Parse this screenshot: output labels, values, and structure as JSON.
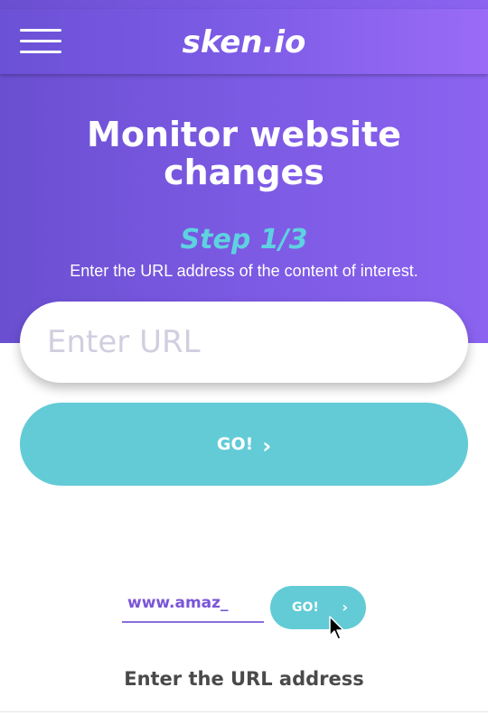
{
  "header": {
    "logo_text": "sken.io",
    "menu_icon": "hamburger-menu-icon"
  },
  "hero": {
    "title_line1": "Monitor website",
    "title_line2": "changes",
    "step": "Step 1/3",
    "subtitle": "Enter the URL address of the content of interest."
  },
  "form": {
    "url_placeholder": "Enter URL",
    "url_value": "",
    "go_label": "GO!",
    "go_icon": "chevron-right-icon"
  },
  "demo": {
    "typed_url": "www.amaz_",
    "go_label": "GO!",
    "cursor_icon": "mouse-pointer-icon",
    "caption": "Enter the URL address"
  },
  "colors": {
    "brand_purple": "#7c5ae3",
    "accent_cyan": "#63cbd6",
    "step_cyan": "#5ed2e0"
  }
}
